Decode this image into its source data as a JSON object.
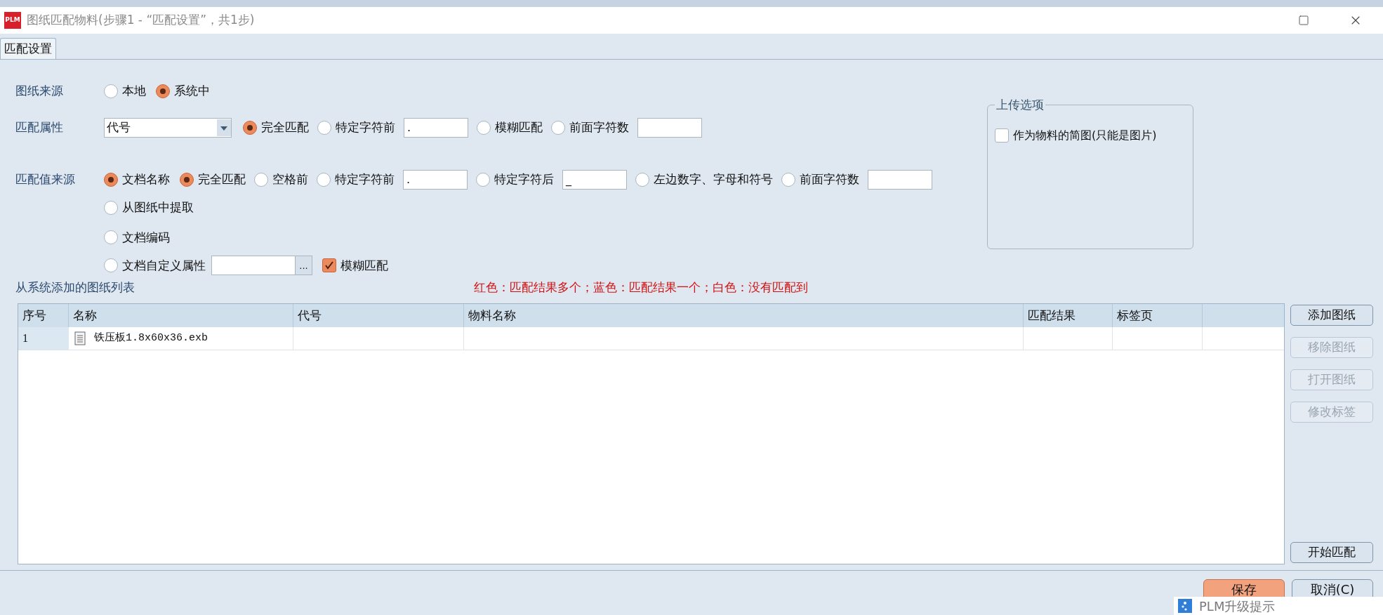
{
  "window": {
    "title": "图纸匹配物料(步骤1 - “匹配设置”，共1步)",
    "app_icon": "PLM"
  },
  "tabs": [
    {
      "label": "匹配设置",
      "selected": true
    }
  ],
  "drawing_source": {
    "label": "图纸来源",
    "options": [
      {
        "label": "本地",
        "selected": false
      },
      {
        "label": "系统中",
        "selected": true
      }
    ]
  },
  "match_attribute": {
    "label": "匹配属性",
    "dropdown": "代号",
    "options": [
      {
        "kind": "radio",
        "label": "完全匹配",
        "selected": true
      },
      {
        "kind": "radio-field",
        "label": "特定字符前",
        "selected": false,
        "value": "."
      },
      {
        "kind": "radio",
        "label": "模糊匹配",
        "selected": false
      },
      {
        "kind": "radio-field",
        "label": "前面字符数",
        "selected": false
      }
    ]
  },
  "match_value_source": {
    "label": "匹配值来源",
    "options": [
      {
        "kind": "radio",
        "label": "文档名称",
        "selected": true,
        "sub_options": [
          {
            "kind": "radio",
            "label": "完全匹配",
            "selected": true
          },
          {
            "kind": "radio",
            "label": "空格前",
            "selected": false
          },
          {
            "kind": "radio-field",
            "label": "特定字符前",
            "selected": false,
            "value": "."
          },
          {
            "kind": "radio-field",
            "label": "特定字符后",
            "selected": false,
            "value": "_"
          },
          {
            "kind": "radio",
            "label": "左边数字、字母和符号",
            "selected": false
          },
          {
            "kind": "radio-field",
            "label": "前面字符数",
            "selected": false
          }
        ]
      },
      {
        "kind": "radio",
        "label": "从图纸中提取",
        "selected": false
      },
      {
        "kind": "radio",
        "label": "文档编码",
        "selected": false
      },
      {
        "kind": "radio-browse",
        "label": "文档自定义属性",
        "selected": false,
        "browse_button": "...",
        "checkbox": {
          "label": "模糊匹配",
          "checked": true
        }
      }
    ]
  },
  "upload_options": {
    "title": "上传选项",
    "checkbox": {
      "label": "作为物料的简图(只能是图片)",
      "checked": false
    }
  },
  "list": {
    "title": "从系统添加的图纸列表",
    "legend": "红色：匹配结果多个；蓝色：匹配结果一个；白色：没有匹配到"
  },
  "table": {
    "columns": [
      "序号",
      "名称",
      "代号",
      "物料名称",
      "匹配结果",
      "标签页"
    ],
    "rows": [
      {
        "index": "1",
        "name": "铁压板1.8x60x36.exb"
      }
    ]
  },
  "side_buttons": [
    {
      "label": "添加图纸",
      "disabled": false
    },
    {
      "label": "移除图纸",
      "disabled": true
    },
    {
      "label": "打开图纸",
      "disabled": true
    },
    {
      "label": "修改标签",
      "disabled": true
    }
  ],
  "start_button": "开始匹配",
  "footer_buttons": [
    {
      "label": "保存",
      "kind": "primary"
    },
    {
      "label": "取消(C)",
      "kind": "default"
    }
  ],
  "notification": {
    "title": "PLM升级提示"
  }
}
